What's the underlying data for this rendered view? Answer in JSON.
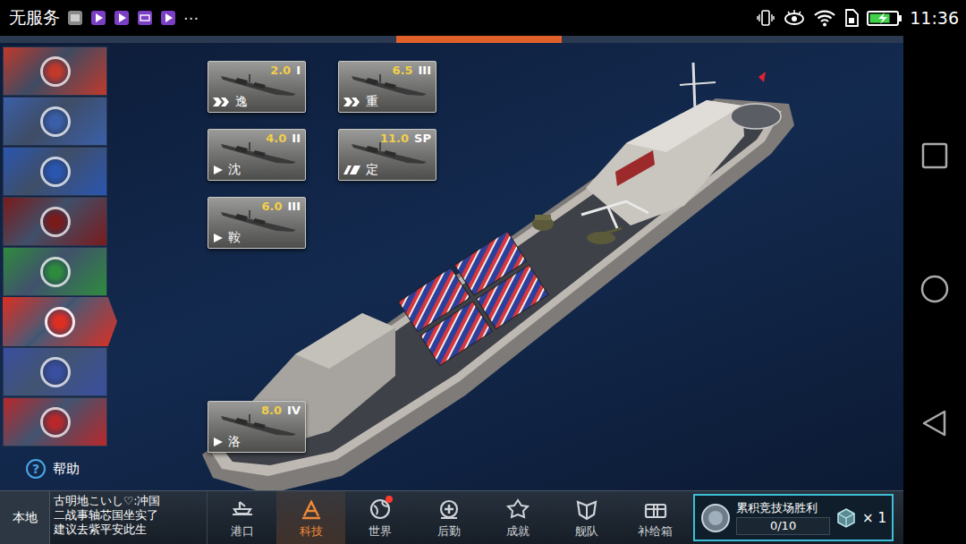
{
  "status_bar": {
    "carrier": "无服务",
    "more": "···",
    "time": "11:36"
  },
  "nations": [
    {
      "selected": false,
      "color": "#c0392b"
    },
    {
      "selected": false,
      "color": "#3a5fa8"
    },
    {
      "selected": false,
      "color": "#2a56b0"
    },
    {
      "selected": false,
      "color": "#7a1b1b"
    },
    {
      "selected": false,
      "color": "#2e8b3e"
    },
    {
      "selected": true,
      "color": "#c0281e"
    },
    {
      "selected": false,
      "color": "#3a4fa0"
    },
    {
      "selected": false,
      "color": "#b8282a"
    }
  ],
  "help": {
    "icon": "?",
    "label": "帮助"
  },
  "tech_tree": {
    "upper": [
      {
        "tier": "2.0",
        "rank": "I",
        "name": "逸",
        "kind": "double"
      },
      {
        "tier": "6.5",
        "rank": "III",
        "name": "重",
        "kind": "double"
      },
      {
        "tier": "4.0",
        "rank": "II",
        "name": "沈",
        "kind": "single"
      },
      {
        "tier": "11.0",
        "rank": "SP",
        "name": "定",
        "kind": "split"
      },
      {
        "tier": "6.0",
        "rank": "III",
        "name": "鞍",
        "kind": "single"
      }
    ],
    "lower": [
      {
        "tier": "8.0",
        "rank": "IV",
        "name": "洛",
        "kind": "single"
      }
    ]
  },
  "chat": {
    "channel": "本地",
    "lines": [
      "古明地こいし♡:冲国",
      "二战事轴芯国坐实了",
      "建议去紫平安此生"
    ]
  },
  "nav": [
    {
      "label": "港口",
      "selected": false,
      "badge": false
    },
    {
      "label": "科技",
      "selected": true,
      "badge": false
    },
    {
      "label": "世界",
      "selected": false,
      "badge": true
    },
    {
      "label": "后勤",
      "selected": false,
      "badge": false
    },
    {
      "label": "成就",
      "selected": false,
      "badge": false
    },
    {
      "label": "舰队",
      "selected": false,
      "badge": false
    },
    {
      "label": "补给箱",
      "selected": false,
      "badge": false
    }
  ],
  "quest": {
    "title": "累积竞技场胜利",
    "progress": "0/10",
    "level": 0,
    "reward": "× 1"
  }
}
